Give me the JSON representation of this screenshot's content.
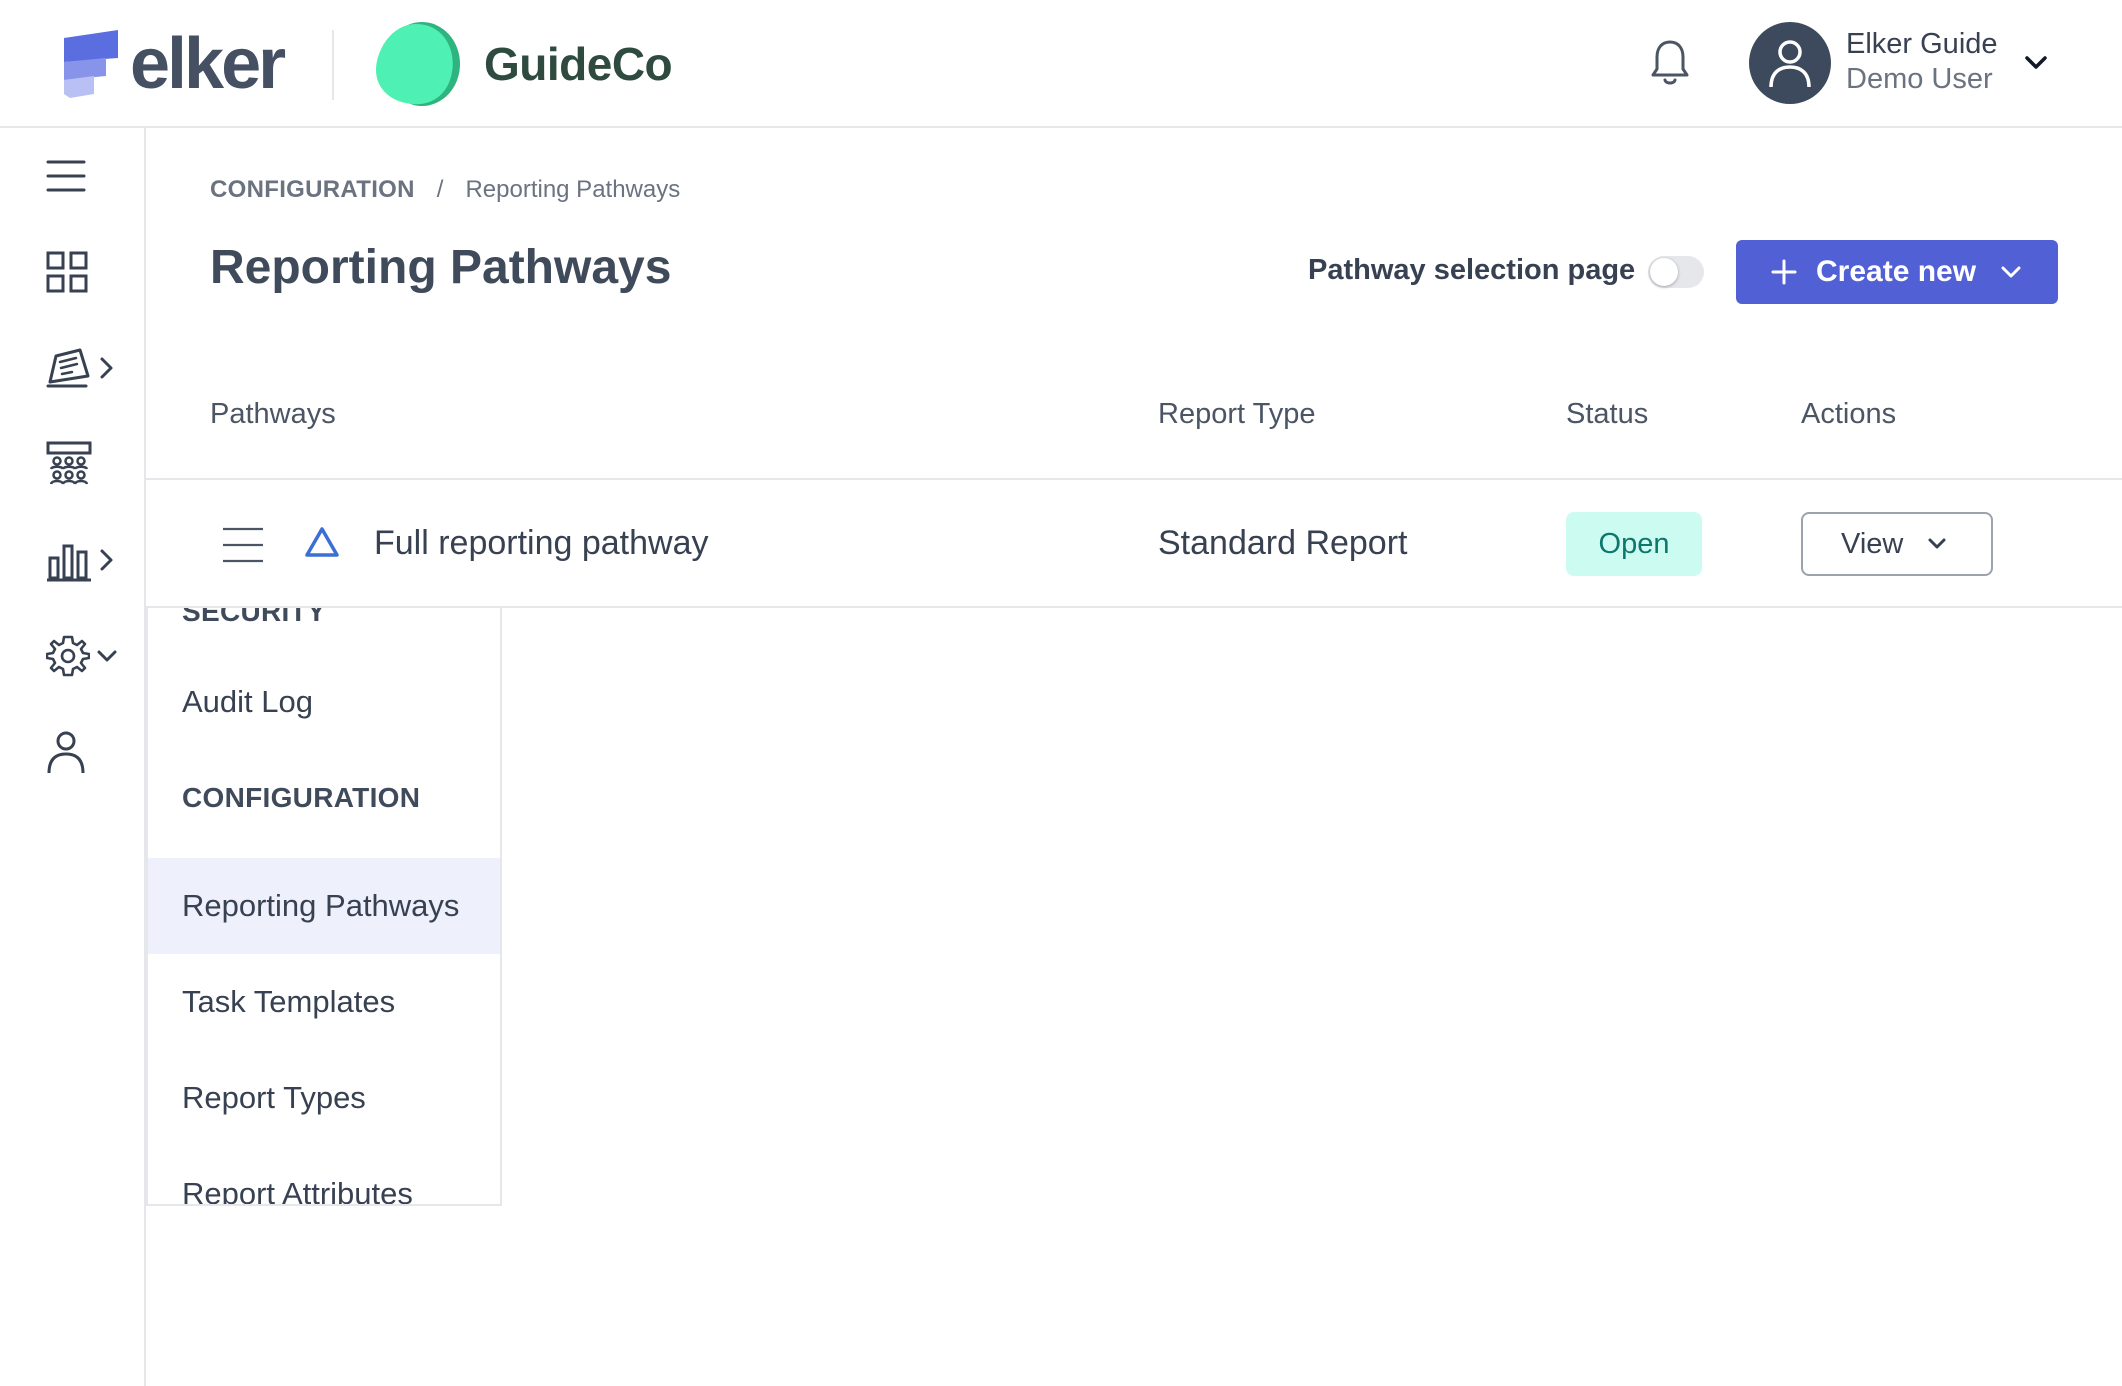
{
  "header": {
    "brand_name": "elker",
    "partner_name": "GuideCo",
    "user": {
      "name": "Elker Guide",
      "role": "Demo User"
    },
    "icons": {
      "notifications": "bell-icon",
      "user_menu": "chevron-down-icon",
      "avatar": "user-icon"
    }
  },
  "rail": {
    "items": [
      {
        "icon": "menu-icon"
      },
      {
        "icon": "dashboard-grid-icon"
      },
      {
        "icon": "reports-icon",
        "has_submenu": true
      },
      {
        "icon": "team-icon"
      },
      {
        "icon": "analytics-bar-chart-icon",
        "has_submenu": true
      },
      {
        "icon": "settings-gear-icon",
        "expanded": true
      },
      {
        "icon": "profile-icon"
      }
    ]
  },
  "breadcrumb": {
    "root": "CONFIGURATION",
    "separator": "/",
    "current": "Reporting Pathways"
  },
  "page": {
    "title": "Reporting Pathways",
    "toggle_label": "Pathway selection page",
    "toggle_on": false,
    "create_label": "Create new"
  },
  "table": {
    "columns": [
      "Pathways",
      "Report Type",
      "Status",
      "Actions"
    ],
    "rows": [
      {
        "name": "Full reporting pathway",
        "report_type": "Standard Report",
        "status": "Open",
        "action": "View"
      }
    ]
  },
  "settings_menu": {
    "items": [
      {
        "label": "SECURITY",
        "type": "heading"
      },
      {
        "label": "Audit Log",
        "type": "link"
      },
      {
        "label": "CONFIGURATION",
        "type": "heading"
      },
      {
        "label": "Reporting Pathways",
        "type": "link",
        "active": true
      },
      {
        "label": "Task Templates",
        "type": "link"
      },
      {
        "label": "Report Types",
        "type": "link"
      },
      {
        "label": "Report Attributes",
        "type": "link"
      }
    ]
  },
  "colors": {
    "primary": "#5260d6",
    "badge_open_bg": "#ccfbf1",
    "badge_open_text": "#0f766e",
    "active_item_bg": "#eef0fc",
    "brand_green": "#4ff0b4",
    "brand_blue": "#5b6ee0"
  }
}
